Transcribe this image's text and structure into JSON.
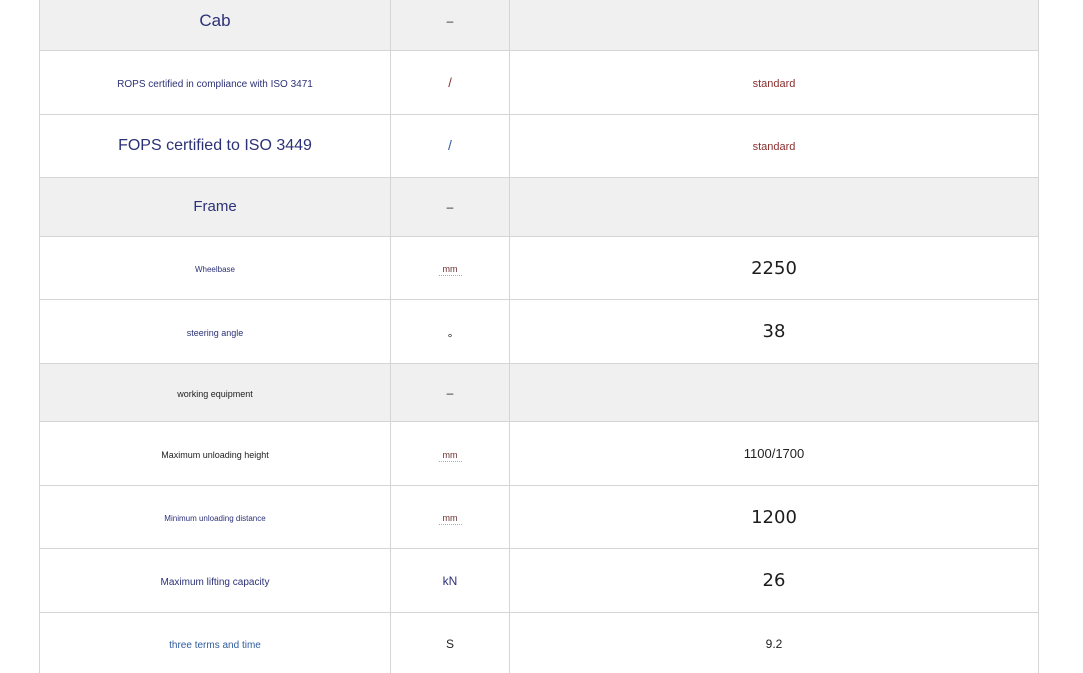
{
  "rows": [
    {
      "type": "section",
      "label": "Cab",
      "unit": "–",
      "value": ""
    },
    {
      "type": "data",
      "label": "ROPS certified in compliance with ISO 3471",
      "unit": "/",
      "value": "standard"
    },
    {
      "type": "data",
      "label": "FOPS certified to ISO 3449",
      "unit": "/",
      "value": "standard"
    },
    {
      "type": "section",
      "label": "Frame",
      "unit": "–",
      "value": ""
    },
    {
      "type": "data",
      "label": "Wheelbase",
      "unit": "mm",
      "value": "2250"
    },
    {
      "type": "data",
      "label": "steering angle",
      "unit": "°",
      "value": "38"
    },
    {
      "type": "section",
      "label": "working equipment",
      "unit": "–",
      "value": ""
    },
    {
      "type": "data",
      "label": "Maximum unloading height",
      "unit": "mm",
      "value": "1100/1700"
    },
    {
      "type": "data",
      "label": "Minimum unloading distance",
      "unit": "mm",
      "value": "1200"
    },
    {
      "type": "data",
      "label": "Maximum lifting capacity",
      "unit": "kN",
      "value": "26"
    },
    {
      "type": "data",
      "label": "three terms and time",
      "unit": "S",
      "value": "9.2"
    }
  ]
}
